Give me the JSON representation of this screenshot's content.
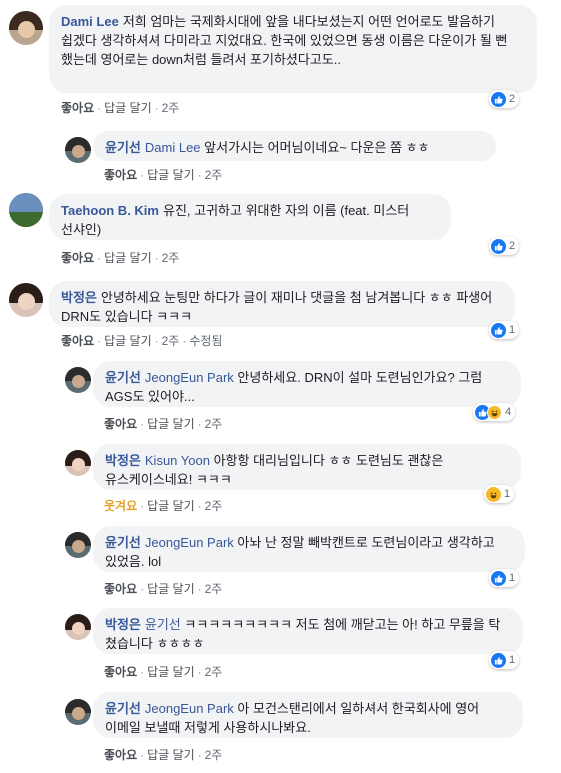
{
  "colors": {
    "link": "#385898",
    "like": "#1877f2",
    "haha": "#f7b928",
    "bubble": "#f2f3f5"
  },
  "comments": [
    {
      "author": "Dami Lee",
      "mention": "",
      "text": "저희 엄마는 국제화시대에 앞을 내다보셨는지 어떤 언어로도 발음하기 쉽겠다 생각하셔셔 다미라고 지었대요. 한국에 있었으면 동생 이름은 다운이가 될 뻔 했는데 영어로는 down처럼 들려서 포기하셨다고도..",
      "like": "좋아요",
      "reply": "답글 달기",
      "time": "2주",
      "edited": "",
      "reaction_count": "2",
      "reactions": [
        "like-icon"
      ]
    },
    {
      "author": "윤기선",
      "mention": "Dami Lee",
      "text": "앞서가시는 어머님이네요~ 다운은 쫌 ㅎㅎ",
      "like": "좋아요",
      "reply": "답글 달기",
      "time": "2주",
      "edited": "",
      "reaction_count": "",
      "reactions": []
    },
    {
      "author": "Taehoon B. Kim",
      "mention": "",
      "text": "유진, 고귀하고 위대한 자의 이름 (feat. 미스터 선샤인)",
      "like": "좋아요",
      "reply": "답글 달기",
      "time": "2주",
      "edited": "",
      "reaction_count": "2",
      "reactions": [
        "like-icon"
      ]
    },
    {
      "author": "박정은",
      "mention": "",
      "text": "안녕하세요 눈팅만 하다가 글이 재미나 댓글을 첨 남겨봅니다 ㅎㅎ 파생어 DRN도 있습니다 ㅋㅋㅋ",
      "like": "좋아요",
      "reply": "답글 달기",
      "time": "2주",
      "edited": "수정됨",
      "reaction_count": "1",
      "reactions": [
        "like-icon"
      ]
    },
    {
      "author": "윤기선",
      "mention": "JeongEun Park",
      "text": "안녕하세요. DRN이 설마 도련님인가요? 그럼 AGS도 있어야...",
      "like": "좋아요",
      "reply": "답글 달기",
      "time": "2주",
      "edited": "",
      "reaction_count": "4",
      "reactions": [
        "like-icon",
        "haha-icon"
      ]
    },
    {
      "author": "박정은",
      "mention": "Kisun Yoon",
      "text": "아항항 대리님입니다 ㅎㅎ 도련님도 괜찮은 유스케이스네요! ㅋㅋㅋ",
      "like": "웃겨요",
      "reply": "답글 달기",
      "time": "2주",
      "edited": "",
      "reaction_count": "1",
      "reactions": [
        "haha-icon"
      ]
    },
    {
      "author": "윤기선",
      "mention": "JeongEun Park",
      "text": "아놔 난 정말 빼박캔트로 도련님이라고 생각하고 있었음. lol",
      "like": "좋아요",
      "reply": "답글 달기",
      "time": "2주",
      "edited": "",
      "reaction_count": "1",
      "reactions": [
        "like-icon"
      ]
    },
    {
      "author": "박정은",
      "mention": "윤기선",
      "text": "ㅋㅋㅋㅋㅋㅋㅋㅋㅋ 저도 첨에 깨닫고는 아! 하고 무릎을 탁 쳤습니다 ㅎㅎㅎㅎ",
      "like": "좋아요",
      "reply": "답글 달기",
      "time": "2주",
      "edited": "",
      "reaction_count": "1",
      "reactions": [
        "like-icon"
      ]
    },
    {
      "author": "윤기선",
      "mention": "JeongEun Park",
      "text": "아 모건스탠리에서 일하셔서 한국회사에 영어 이메일 보낼때 저렇게 사용하시나봐요.",
      "like": "좋아요",
      "reply": "답글 달기",
      "time": "2주",
      "edited": "",
      "reaction_count": "",
      "reactions": []
    }
  ]
}
